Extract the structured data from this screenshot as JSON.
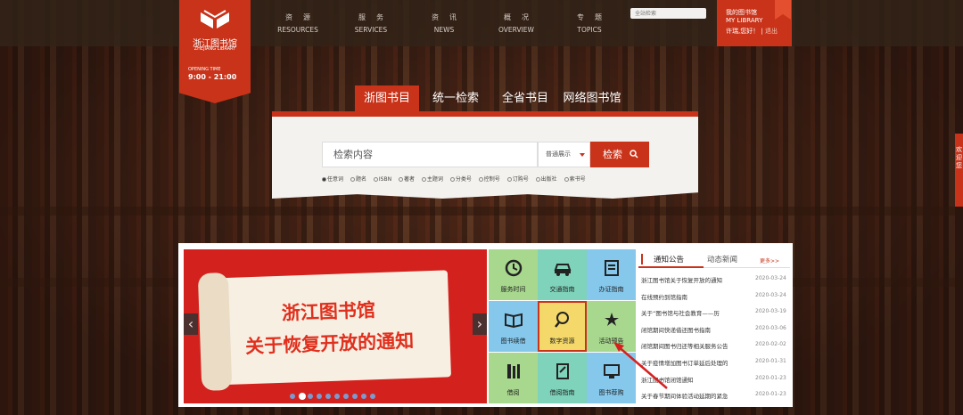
{
  "header": {
    "logo_cn": "浙江图书馆",
    "logo_en": "ZHEJIANG LIBRARY",
    "opening_label": "OPENING TIME",
    "opening_hours": "9:00 - 21:00",
    "nav": [
      {
        "zh": "资源",
        "en": "RESOURCES"
      },
      {
        "zh": "服务",
        "en": "SERVICES"
      },
      {
        "zh": "资讯",
        "en": "NEWS"
      },
      {
        "zh": "概况",
        "en": "OVERVIEW"
      },
      {
        "zh": "专题",
        "en": "TOPICS"
      }
    ],
    "site_search_placeholder": "全站检索",
    "mylib_cn": "我的图书馆",
    "mylib_en": "MY LIBRARY",
    "greeting": "许瑞,您好！",
    "logout": "退出"
  },
  "search": {
    "tabs": [
      "浙图书目",
      "统一检索",
      "全省书目",
      "网络图书馆"
    ],
    "input_value": "检索内容",
    "mode_select": "普通展示",
    "button": "检索",
    "fields": [
      "任意词",
      "题名",
      "ISBN",
      "著者",
      "主题词",
      "分类号",
      "控制号",
      "订购号",
      "出版社",
      "索书号"
    ]
  },
  "banner": {
    "line1": "浙江图书馆",
    "line2": "关于恢复开放的通知",
    "slide_count": 10,
    "active_slide": 2
  },
  "services": [
    {
      "label": "服务时间",
      "icon": "clock-icon",
      "color": "#a8d88e"
    },
    {
      "label": "交通指南",
      "icon": "car-icon",
      "color": "#7fd3ba"
    },
    {
      "label": "办证指南",
      "icon": "card-icon",
      "color": "#85c8ec"
    },
    {
      "label": "图书续借",
      "icon": "book-icon",
      "color": "#85c8ec"
    },
    {
      "label": "数字资源",
      "icon": "search-doc-icon",
      "color": "#f4d86a"
    },
    {
      "label": "活动预告",
      "icon": "star-person-icon",
      "color": "#a8d88e"
    },
    {
      "label": "借阅",
      "icon": "bookshelf-icon",
      "color": "#a8d88e"
    },
    {
      "label": "借阅指南",
      "icon": "guide-icon",
      "color": "#7fd3ba"
    },
    {
      "label": "图书荐购",
      "icon": "computer-icon",
      "color": "#85c8ec"
    }
  ],
  "news": {
    "tab_active": "通知公告",
    "tab_other": "动态新闻",
    "more": "更多>>",
    "items": [
      {
        "title": "浙江图书馆关于恢复开放的通知",
        "date": "2020-03-24"
      },
      {
        "title": "在线预约到馆指南",
        "date": "2020-03-24"
      },
      {
        "title": "关于“图书馆与社会教育——历",
        "date": "2020-03-19"
      },
      {
        "title": "闭馆期间快递借还图书指南",
        "date": "2020-03-06"
      },
      {
        "title": "闭馆期间图书归还等相关服务公告",
        "date": "2020-02-02"
      },
      {
        "title": "关于疫情增加图书订单延后处理的",
        "date": "2020-01-31"
      },
      {
        "title": "浙江图书馆闭馆通知",
        "date": "2020-01-23"
      },
      {
        "title": "关于春节期间体验活动延期的紧急",
        "date": "2020-01-23"
      }
    ]
  },
  "side_float": "欢迎您"
}
